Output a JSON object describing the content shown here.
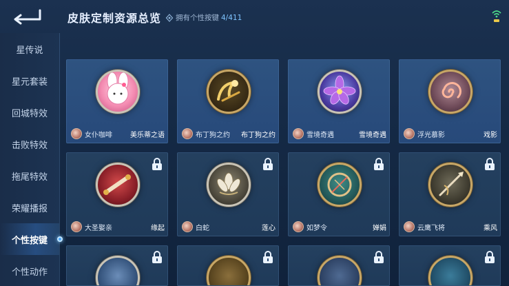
{
  "header": {
    "title": "皮肤定制资源总览",
    "owned_label": "拥有个性按键",
    "owned_count": "4/411"
  },
  "sidebar": {
    "items": [
      {
        "label": "星传说",
        "active": false
      },
      {
        "label": "星元套装",
        "active": false
      },
      {
        "label": "回城特效",
        "active": false
      },
      {
        "label": "击败特效",
        "active": false
      },
      {
        "label": "拖尾特效",
        "active": false
      },
      {
        "label": "荣耀播报",
        "active": false
      },
      {
        "label": "个性按键",
        "active": true
      },
      {
        "label": "个性动作",
        "active": false
      }
    ]
  },
  "cards": [
    {
      "hero": "女仆咖啡",
      "skin": "美乐蒂之语",
      "locked": false,
      "icon": "melody-icon"
    },
    {
      "hero": "布丁狗之约",
      "skin": "布丁狗之约",
      "locked": false,
      "icon": "golden-wand-icon"
    },
    {
      "hero": "雪境奇遇",
      "skin": "雪境奇遇",
      "locked": false,
      "icon": "purple-flower-icon"
    },
    {
      "hero": "浮光慕影",
      "skin": "戏影",
      "locked": false,
      "icon": "spiral-icon"
    },
    {
      "hero": "大圣娶亲",
      "skin": "缘起",
      "locked": true,
      "icon": "scroll-icon"
    },
    {
      "hero": "白蛇",
      "skin": "莲心",
      "locked": true,
      "icon": "lotus-icon"
    },
    {
      "hero": "如梦令",
      "skin": "婵娟",
      "locked": true,
      "icon": "moon-harp-icon"
    },
    {
      "hero": "云鹰飞将",
      "skin": "乘风",
      "locked": true,
      "icon": "spear-icon"
    },
    {
      "hero": "",
      "skin": "",
      "locked": true,
      "icon": "feather-icon"
    },
    {
      "hero": "",
      "skin": "",
      "locked": true,
      "icon": "gold-icon"
    },
    {
      "hero": "",
      "skin": "",
      "locked": true,
      "icon": "wave-icon"
    },
    {
      "hero": "",
      "skin": "",
      "locked": true,
      "icon": "dragon-icon"
    }
  ]
}
